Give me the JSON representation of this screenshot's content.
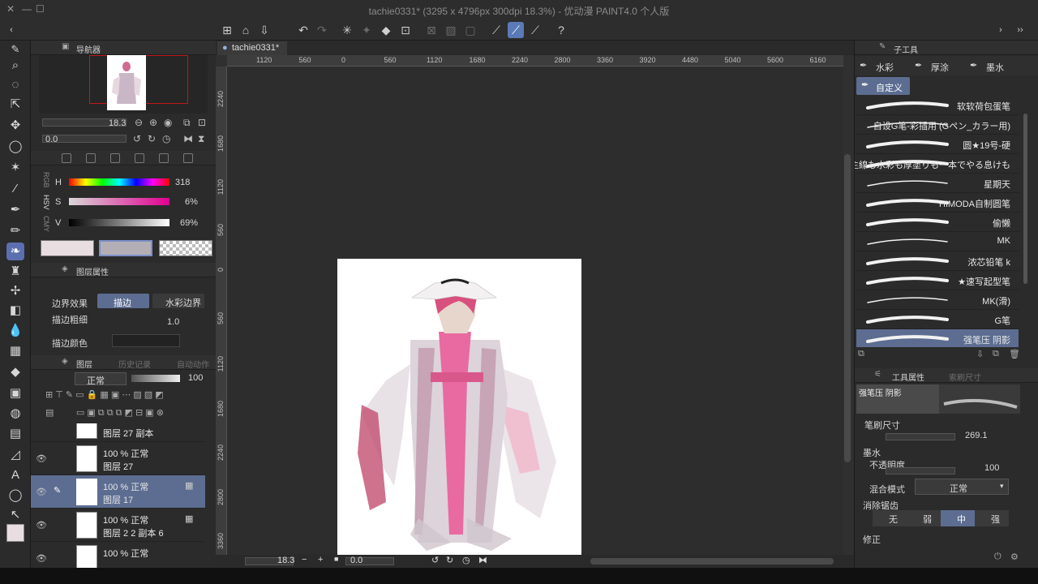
{
  "window": {
    "title": "tachie0331* (3295 x 4796px 300dpi 18.3%) - 优动漫 PAINT4.0 个人版"
  },
  "navigator": {
    "title": "导航器",
    "zoom": "18.3",
    "rotate": "0.0"
  },
  "color": {
    "mode_rgb": "RGB",
    "mode_hsv": "HSV",
    "mode_cmy": "CMY",
    "h_label": "H",
    "s_label": "S",
    "v_label": "V",
    "h_value": "318",
    "s_value": "6%",
    "v_value": "69%",
    "main_color": "#e8dde1",
    "sub_color": "#b4aeb6"
  },
  "layer_property": {
    "title": "图层属性",
    "border_effect_label": "边界效果",
    "option_stroke": "描边",
    "option_watercolor": "水彩边界",
    "stroke_width_label": "描边粗细",
    "stroke_width_value": "1.0",
    "stroke_color_label": "描边颜色"
  },
  "layers": {
    "tab_layer": "图层",
    "tab_history": "历史记录",
    "tab_auto": "自动动作",
    "blend_mode": "正常",
    "opacity": "100",
    "rows": [
      {
        "opacity": "",
        "name": "图层 27 副本"
      },
      {
        "opacity": "100 %  正常",
        "name": "图层 27"
      },
      {
        "opacity": "100 %  正常",
        "name": "图层 17"
      },
      {
        "opacity": "100 %  正常",
        "name": "图层 2 2 副本 6"
      },
      {
        "opacity": "100 %  正常",
        "name": ""
      }
    ]
  },
  "canvas": {
    "tab_label": "tachie0331*",
    "ruler_h": [
      "1120",
      "560",
      "0",
      "560",
      "1120",
      "1680",
      "2240",
      "2800",
      "3360",
      "3920",
      "4480",
      "5040",
      "5600",
      "6160"
    ],
    "ruler_v": [
      "2240",
      "1680",
      "1120",
      "560",
      "0",
      "560",
      "1120",
      "1680",
      "2240",
      "2800",
      "3360"
    ],
    "zoom": "18.3",
    "rotate": "0.0"
  },
  "subtool": {
    "title": "子工具",
    "tabs": [
      "水彩",
      "厚涂",
      "墨水",
      "自定义"
    ],
    "brushes": [
      "软软荷包蛋笔",
      "自设G笔-彩插用 (Gペン_カラー用)",
      "圆★19号-硬",
      "主線も水彩も厚塗りも一本でやる息けも",
      "星期天",
      "HIMODA自制圆笔",
      "偷懒",
      "MK",
      "浓芯铅笔 k",
      "★速写起型笔",
      "MK(滑)",
      "G笔",
      "强笔压 阴影"
    ]
  },
  "tool_property": {
    "title": "工具属性",
    "title2": "索刷尺寸",
    "preview_name": "强笔压 阴影",
    "brush_size_label": "笔刷尺寸",
    "brush_size_value": "269.1",
    "ink_label": "墨水",
    "opacity_label": "不透明度",
    "opacity_value": "100",
    "blend_label": "混合模式",
    "blend_value": "正常",
    "aa_label": "消除锯齿",
    "aa_options": [
      "无",
      "弱",
      "中",
      "强"
    ],
    "correction_label": "修正"
  }
}
